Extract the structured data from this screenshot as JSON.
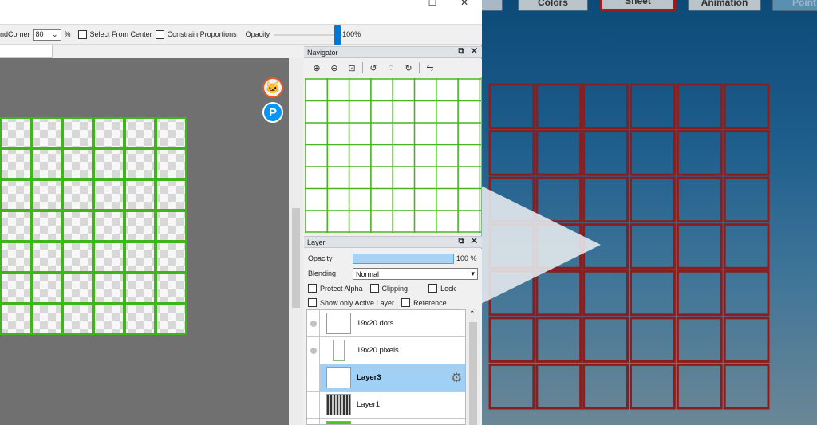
{
  "background_app": {
    "tabs": [
      "",
      "Colors",
      "Sheet",
      "Animation",
      "Point"
    ],
    "active_tab": "Sheet",
    "grid": {
      "columns": 6,
      "rows": 7,
      "line_color": "#8a1e1e"
    }
  },
  "window": {
    "controls": {
      "maximize": "☐",
      "close": "✕"
    }
  },
  "options_bar": {
    "round_corner_label": "ndCorner",
    "round_corner_value": "80",
    "percent_sign": "%",
    "select_from_center": "Select From Center",
    "constrain_proportions": "Constrain Proportions",
    "opacity_label": "Opacity",
    "opacity_value": "100%",
    "opacity_fraction": 0.97
  },
  "canvas": {
    "grid": {
      "columns": 6,
      "rows": 7,
      "line_color": "#3fb51b"
    },
    "floating_icons": [
      "mascot-icon",
      "pixiv-p-icon"
    ]
  },
  "navigator": {
    "title": "Navigator",
    "header_buttons": "⧉ ✕",
    "tools": [
      "zoom-in-icon",
      "zoom-out-icon",
      "fit-view-icon",
      "rotate-left-icon",
      "reset-rotation-icon",
      "rotate-right-icon",
      "flip-horizontal-icon"
    ],
    "preview_grid": {
      "columns": 8,
      "rows": 7
    }
  },
  "layer_panel": {
    "title": "Layer",
    "header_buttons": "⧉ ✕",
    "opacity_label": "Opacity",
    "opacity_value": "100 %",
    "blending_label": "Blending",
    "blending_value": "Normal",
    "protect_alpha": "Protect Alpha",
    "clipping": "Clipping",
    "lock": "Lock",
    "show_only_active": "Show only Active Layer",
    "reference": "Reference",
    "layers": [
      {
        "name": "19x20 dots",
        "visible_dot": true,
        "active": false
      },
      {
        "name": "19x20 pixels",
        "visible_dot": true,
        "active": false
      },
      {
        "name": "Layer3",
        "visible_dot": false,
        "active": true
      },
      {
        "name": "Layer1",
        "visible_dot": false,
        "active": false
      }
    ]
  }
}
